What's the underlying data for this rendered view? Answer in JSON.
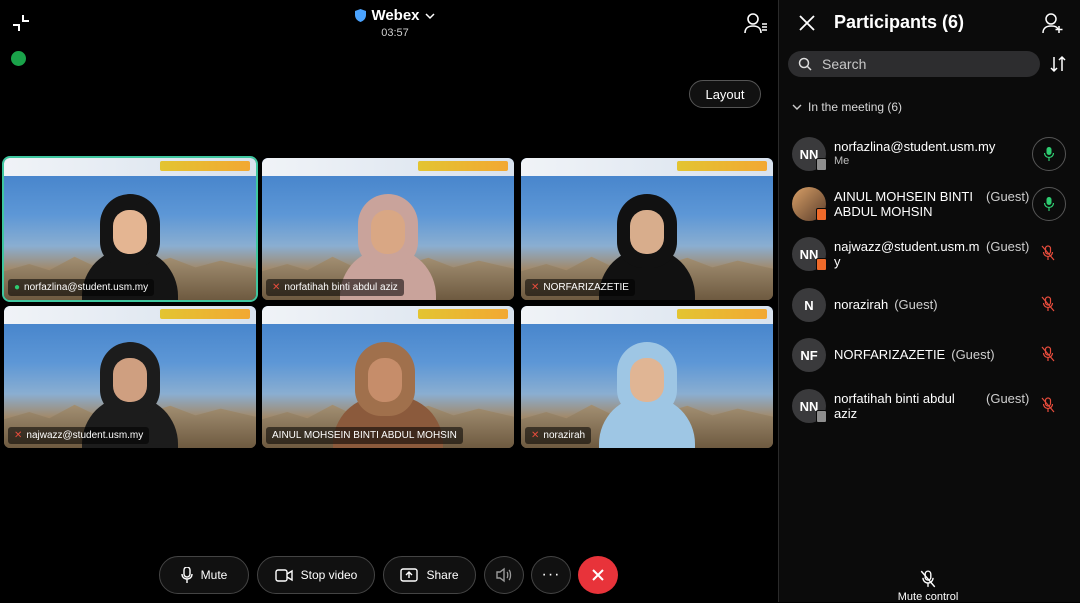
{
  "header": {
    "app_title": "Webex",
    "timer": "03:57",
    "layout_label": "Layout"
  },
  "tiles": [
    {
      "name": "norfazlina@student.usm.my",
      "mic": "on"
    },
    {
      "name": "norfatihah binti abdul aziz",
      "mic": "off"
    },
    {
      "name": "NORFARIZAZETIE",
      "mic": "off"
    },
    {
      "name": "najwazz@student.usm.my",
      "mic": "off"
    },
    {
      "name": "AINUL MOHSEIN BINTI ABDUL MOHSIN",
      "mic": "none"
    },
    {
      "name": "norazirah",
      "mic": "off"
    }
  ],
  "controls": {
    "mute_label": "Mute",
    "stop_video_label": "Stop video",
    "share_label": "Share"
  },
  "panel": {
    "title": "Participants (6)",
    "search_placeholder": "Search",
    "section_label": "In the meeting (6)",
    "participants": [
      {
        "initials": "NN",
        "name": "norfazlina@student.usm.my",
        "sub": "Me",
        "guest": "",
        "mic": "on"
      },
      {
        "initials": "",
        "name": "AINUL MOHSEIN BINTI ABDUL MOHSIN",
        "sub": "",
        "guest": "(Guest)",
        "mic": "on"
      },
      {
        "initials": "NN",
        "name": "najwazz@student.usm.my",
        "sub": "",
        "guest": "(Guest)",
        "mic": "off"
      },
      {
        "initials": "N",
        "name": "norazirah",
        "sub": "",
        "guest": "(Guest)",
        "mic": "off"
      },
      {
        "initials": "NF",
        "name": "NORFARIZAZETIE",
        "sub": "",
        "guest": "(Guest)",
        "mic": "off"
      },
      {
        "initials": "NN",
        "name": "norfatihah binti abdul aziz",
        "sub": "",
        "guest": "(Guest)",
        "mic": "off"
      }
    ],
    "mute_control_label": "Mute control"
  },
  "colors": {
    "end_call": "#e8333a",
    "mic_on": "#2ecc71",
    "mic_off": "#e74c3c",
    "active_tile_outline": "#3fc7a0"
  }
}
